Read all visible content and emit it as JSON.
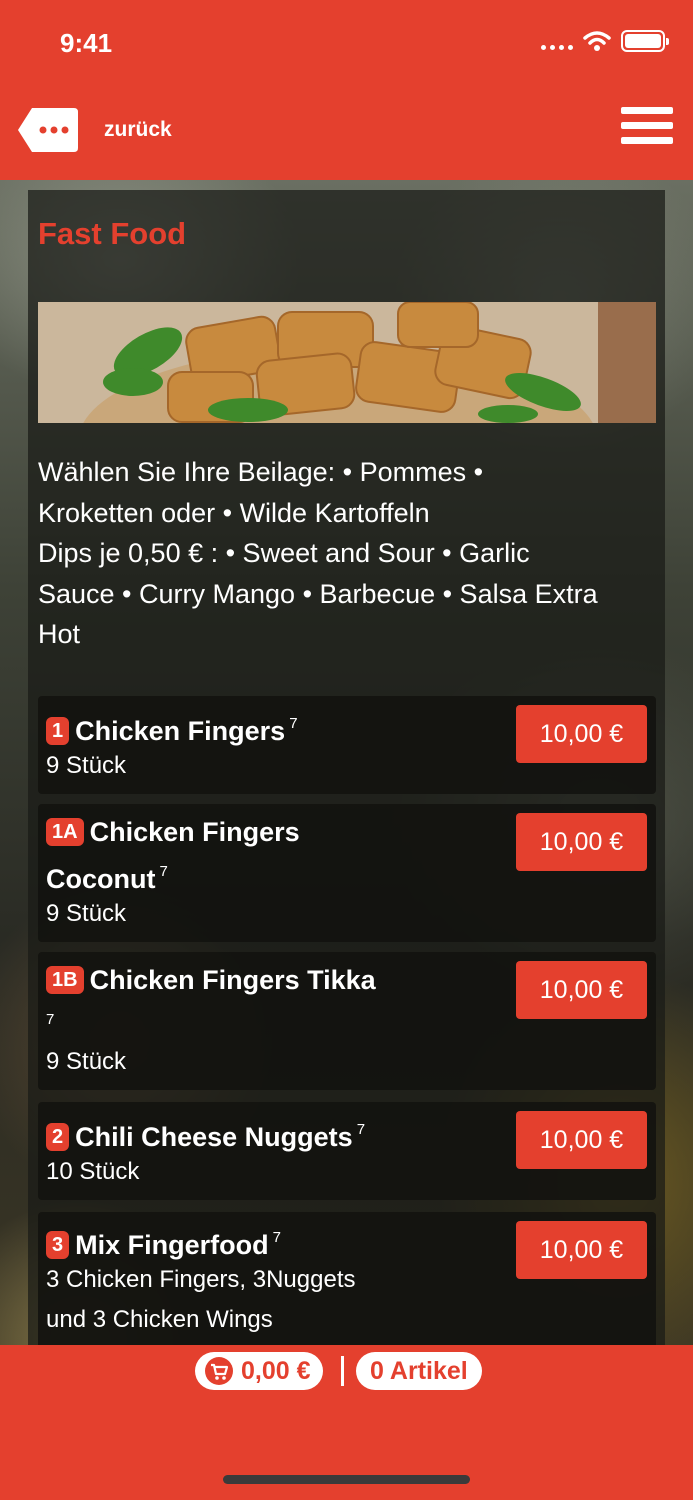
{
  "status": {
    "time": "9:41"
  },
  "header": {
    "back_label": "zurück"
  },
  "category": {
    "title": "Fast Food",
    "description_lines": [
      "Wählen Sie Ihre Beilage: • Pommes •",
      "Kroketten oder • Wilde Kartoffeln",
      "Dips je 0,50 € : • Sweet and Sour • Garlic",
      "Sauce • Curry Mango • Barbecue • Salsa Extra",
      "Hot"
    ]
  },
  "items": [
    {
      "number": "1",
      "name_lines": [
        "Chicken Fingers"
      ],
      "sup": "7",
      "details": [
        "9 Stück"
      ],
      "price": "10,00 €"
    },
    {
      "number": "1A",
      "name_lines": [
        "Chicken Fingers",
        "Coconut"
      ],
      "sup": "7",
      "details": [
        "9 Stück"
      ],
      "price": "10,00 €"
    },
    {
      "number": "1B",
      "name_lines": [
        "Chicken Fingers Tikka"
      ],
      "sup": "7",
      "details": [
        "9 Stück"
      ],
      "price": "10,00 €"
    },
    {
      "number": "2",
      "name_lines": [
        "Chili Cheese Nuggets"
      ],
      "sup": "7",
      "details": [
        "10 Stück"
      ],
      "price": "10,00 €"
    },
    {
      "number": "3",
      "name_lines": [
        "Mix Fingerfood"
      ],
      "sup": "7",
      "details": [
        "3 Chicken Fingers, 3Nuggets",
        "und 3 Chicken Wings"
      ],
      "price": "10,00 €"
    }
  ],
  "cart": {
    "total": "0,00 €",
    "count_label": "0 Artikel"
  },
  "colors": {
    "accent": "#e4402e"
  },
  "icons": {
    "back": "speech-bubble-dots-icon",
    "menu": "hamburger-menu-icon",
    "cart": "shopping-cart-icon",
    "wifi": "wifi-icon",
    "battery": "battery-icon",
    "signal": "cellular-signal-icon"
  }
}
